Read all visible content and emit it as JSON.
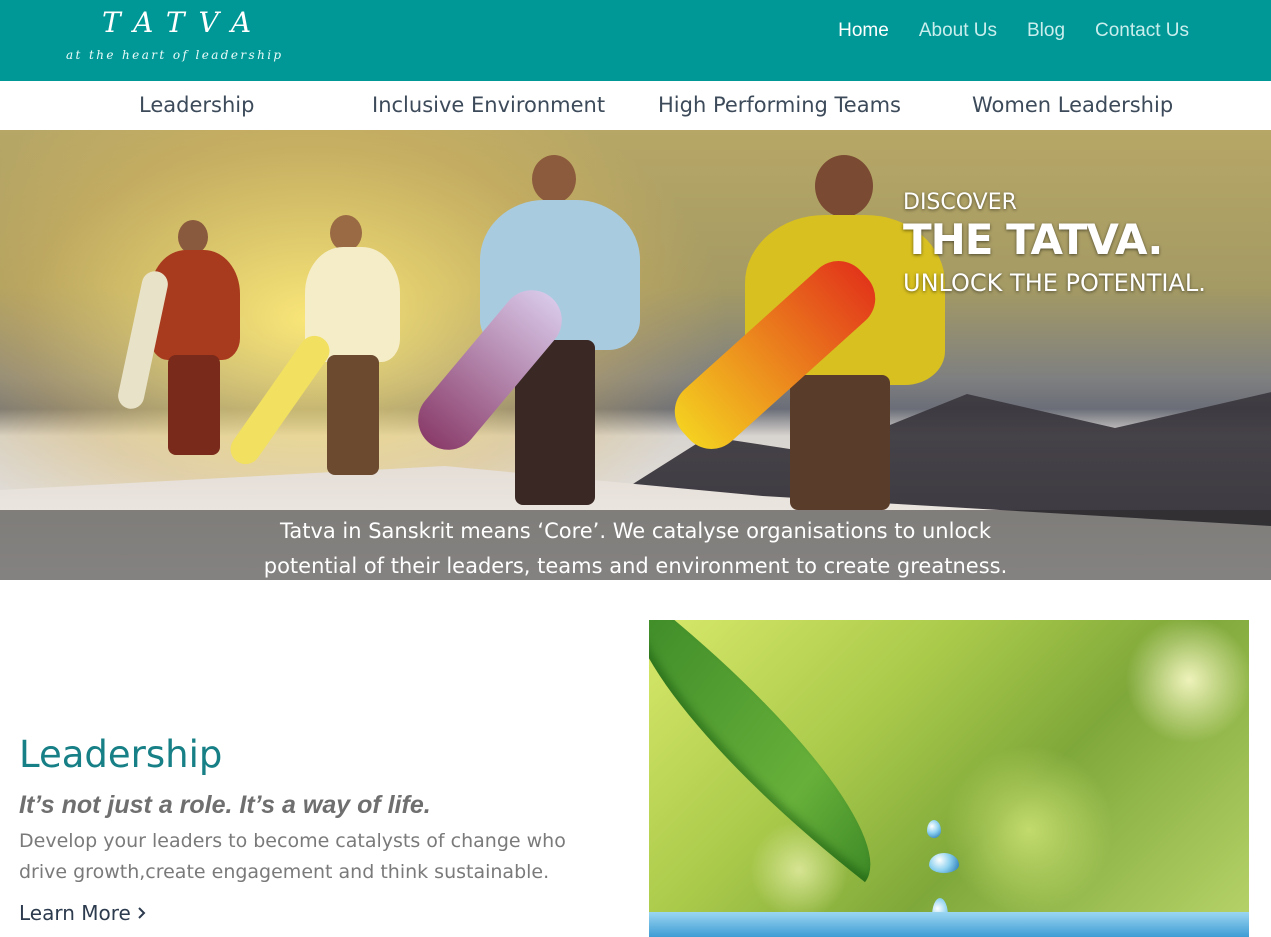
{
  "logo": {
    "wordmark": "TATVA",
    "tagline": "at the heart of leadership"
  },
  "topnav": {
    "items": [
      {
        "label": "Home",
        "active": true
      },
      {
        "label": "About Us",
        "active": false
      },
      {
        "label": "Blog",
        "active": false
      },
      {
        "label": "Contact Us",
        "active": false
      }
    ]
  },
  "subnav": {
    "items": [
      {
        "label": "Leadership"
      },
      {
        "label": "Inclusive Environment"
      },
      {
        "label": "High Performing Teams"
      },
      {
        "label": "Women Leadership"
      }
    ]
  },
  "hero": {
    "discover": "DISCOVER",
    "title": "THE TATVA.",
    "unlock": "UNLOCK THE POTENTIAL.",
    "caption_line1": "Tatva in Sanskrit means ‘Core’. We catalyse organisations to unlock",
    "caption_line2": "potential of their leaders, teams and environment to create greatness."
  },
  "leadership": {
    "title": "Leadership",
    "tagline": "It’s not just a role. It’s a way of life.",
    "description": "Develop your leaders to become catalysts of change who drive growth,create engagement and think sustainable.",
    "cta": "Learn More",
    "cta_icon": "chevron-right-icon"
  },
  "colors": {
    "brand_teal": "#009896",
    "heading_teal": "#177f86",
    "nav_text": "#3c4a5a"
  }
}
